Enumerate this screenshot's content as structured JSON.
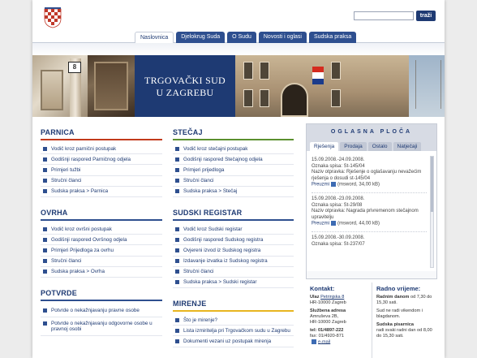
{
  "header": {
    "search_button": "traži",
    "search_placeholder": ""
  },
  "nav": {
    "tabs": [
      "Naslovnica",
      "Djelokrug Suda",
      "O Sudu",
      "Novosti i oglasi",
      "Sudska praksa"
    ]
  },
  "banner": {
    "house_number": "8",
    "court_name_line1": "TRGOVAČKI SUD",
    "court_name_line2": "U ZAGREBU"
  },
  "sections": {
    "parnica": {
      "title": "PARNICA",
      "items": [
        "Vodič kroz parnični postupak",
        "Godišnji raspored Parničnog odjela",
        "Primjeri tužbi",
        "Stručni članci",
        "Sudska praksa > Parnica"
      ]
    },
    "ovrha": {
      "title": "OVRHA",
      "items": [
        "Vodič kroz ovršni postupak",
        "Godišnji raspored Ovršnog odjela",
        "Primjeri Prijedloga za ovrhu",
        "Stručni članci",
        "Sudska praksa > Ovrha"
      ]
    },
    "potvrde": {
      "title": "POTVRDE",
      "items": [
        "Potvrde o nekažnjavanju pravne osobe",
        "Potvrde o nekažnjavanju odgovorne osobe u pravnoj osobi"
      ]
    },
    "stecaj": {
      "title": "STEČAJ",
      "items": [
        "Vodič kroz stečajni postupak",
        "Godišnji raspored Stečajnog odjela",
        "Primjeri prijedloga",
        "Stručni članci",
        "Sudska praksa > Stečaj"
      ]
    },
    "registar": {
      "title": "SUDSKI REGISTAR",
      "items": [
        "Vodič kroz Sudski registar",
        "Godišnji raspored Sudskog registra",
        "Ovjereni izvod iz Sudskog registra",
        "Izdavanje izvatka iz Sudskog registra",
        "Stručni članci",
        "Sudska praksa > Sudski registar"
      ]
    },
    "mirenje": {
      "title": "MIRENJE",
      "items": [
        "Što je mirenje?",
        "Lista izmiritelja pri Trgovačkom sudu u Zagrebu",
        "Dokumenti vezani uz postupak mirenja"
      ]
    }
  },
  "notice_board": {
    "title": "OGLASNA PLOČA",
    "tabs": [
      "Rješenja",
      "Prodaja",
      "Ostalo",
      "Natječaji"
    ],
    "entries": [
      {
        "dates": "15.09.2008.-24.09.2008.",
        "case": "Oznaka spisa: St-145/04",
        "subject": "Naziv otpravka: Rješenje o oglašavanju nevažećim rješenja o dosudi st-145/04",
        "download": "Preuzmi",
        "file": "(msword, 34,00 kB)"
      },
      {
        "dates": "15.09.2008.-23.09.2008.",
        "case": "Oznaka spisa: St-29/08",
        "subject": "Naziv otpravka: Nagrada privremenom stečajnom upravitelju",
        "download": "Preuzmi",
        "file": "(msword, 44,00 kB)"
      },
      {
        "dates": "15.09.2008.-30.09.2008.",
        "case": "Oznaka spisa: St-237/07",
        "subject": "",
        "download": "",
        "file": ""
      }
    ]
  },
  "contact": {
    "title": "Kontakt:",
    "address_label": "Ulaz",
    "address_link": "Petrinjska 8",
    "address_city": "HR-10000 Zagreb",
    "mail_label": "Službena adresa",
    "mail_street": "Amruševa 2B,",
    "mail_city": "HR-10000 Zagreb",
    "tel": "tel: 01/4897-222",
    "fax": "fax: 01/4920-871",
    "email": "e-mail"
  },
  "hours": {
    "title": "Radno vrijeme:",
    "line1_bold": "Radnim danom",
    "line1": "od 7,30 do 15,30 sati.",
    "line2": "Sud ne radi vikendom i blagdanom.",
    "line3_bold": "Sudska pisarnica",
    "line3": "radi svaki radni dan od 8,00 do 15,30 sati."
  },
  "colors": {
    "brand_blue": "#1e3a73",
    "tab_blue": "#2e4f8f",
    "parnica_accent": "#c2391b",
    "stecaj_accent": "#5a8f2e",
    "mirenje_accent": "#e8b520"
  }
}
